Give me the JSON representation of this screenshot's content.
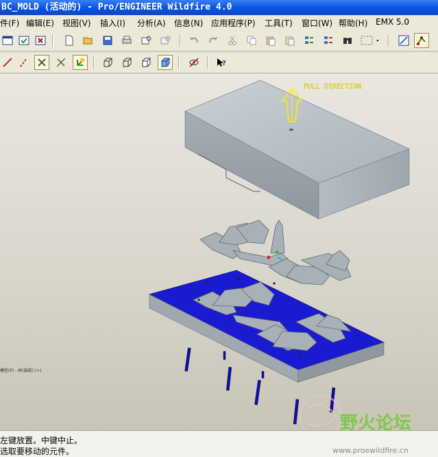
{
  "window": {
    "title": "BC_MOLD (活动的) - Pro/ENGINEER Wildfire 4.0"
  },
  "menu": {
    "items": [
      {
        "label": "件(F)"
      },
      {
        "label": "编辑(E)"
      },
      {
        "label": "视图(V)"
      },
      {
        "label": "插入(I)"
      },
      {
        "label": "分析(A)"
      },
      {
        "label": "信息(N)"
      },
      {
        "label": "应用程序(P)"
      },
      {
        "label": "工具(T)"
      },
      {
        "label": "窗口(W)"
      },
      {
        "label": "帮助(H)"
      },
      {
        "label": "EMX 5.0"
      }
    ]
  },
  "viewport": {
    "pull_direction_label": "PULL DIRECTION",
    "side_note": "模型(P) - 树(装配) (+)"
  },
  "status": {
    "line1": "左键放置。中键中止。",
    "line2": "选取要移动的元件。"
  },
  "watermark": {
    "brand": "野火论坛",
    "url": "www.proewildfire.cn"
  },
  "colors": {
    "titlebar": "#0a54e3",
    "cavity_blue": "#1a1ad0",
    "part_gray": "#a8b0b8",
    "pull_arrow": "#ffee00",
    "watermark_green": "#7ec850"
  }
}
